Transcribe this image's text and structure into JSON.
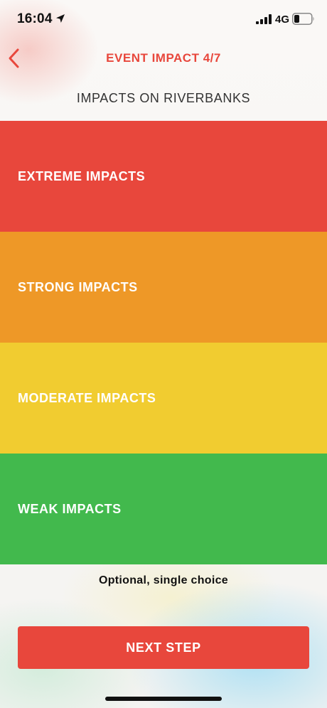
{
  "status_bar": {
    "time": "16:04",
    "network": "4G",
    "location_icon": "location-arrow-icon",
    "signal_icon": "signal-bars-icon",
    "battery_icon": "battery-icon"
  },
  "header": {
    "back_icon": "chevron-left-icon",
    "title": "EVENT IMPACT 4/7",
    "question": "IMPACTS ON RIVERBANKS"
  },
  "options": [
    {
      "label": "EXTREME IMPACTS",
      "color": "#e8473c"
    },
    {
      "label": "STRONG IMPACTS",
      "color": "#ee9827"
    },
    {
      "label": "MODERATE IMPACTS",
      "color": "#f1cc30"
    },
    {
      "label": "WEAK IMPACTS",
      "color": "#42b94d"
    }
  ],
  "hint": "Optional, single choice",
  "next_button": {
    "label": "NEXT STEP",
    "color": "#e8473c"
  },
  "accent_color": "#e8473c"
}
